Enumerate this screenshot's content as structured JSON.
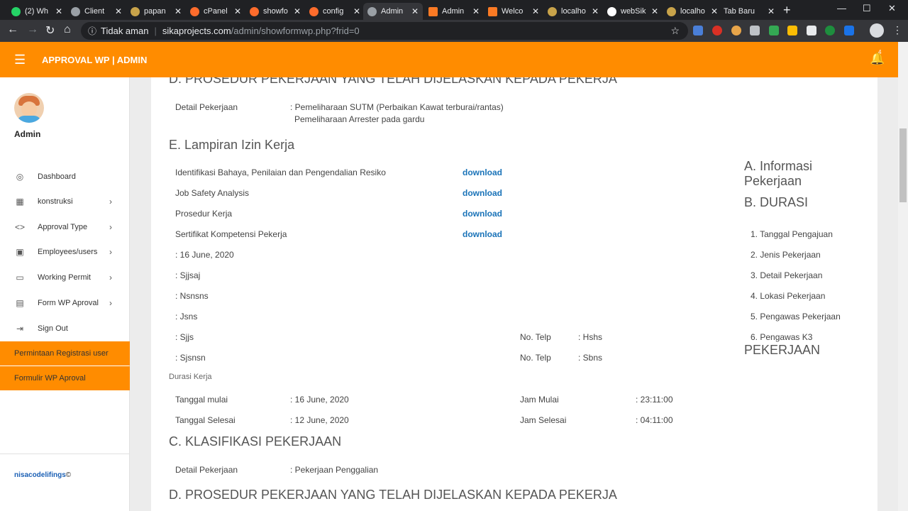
{
  "browser": {
    "tabs": [
      {
        "label": "(2) Wh",
        "icon": "whatsapp-icon",
        "color": "#25d366"
      },
      {
        "label": "Client",
        "icon": "shield-icon",
        "color": "#9aa0a6"
      },
      {
        "label": "papan",
        "icon": "crown-icon",
        "color": "#c8a34a"
      },
      {
        "label": "cPanel",
        "icon": "cpanel-icon",
        "color": "#ff6c2c"
      },
      {
        "label": "showfo",
        "icon": "cpanel-icon",
        "color": "#ff6c2c"
      },
      {
        "label": "config",
        "icon": "cpanel-icon",
        "color": "#ff6c2c"
      },
      {
        "label": "Admin",
        "icon": "globe-icon",
        "color": "#9aa0a6"
      },
      {
        "label": "Admin",
        "icon": "xampp-icon",
        "color": "#fb7a24"
      },
      {
        "label": "Welco",
        "icon": "xampp-icon",
        "color": "#fb7a24"
      },
      {
        "label": "localho",
        "icon": "crown-icon",
        "color": "#c8a34a"
      },
      {
        "label": "webSik",
        "icon": "github-icon",
        "color": "#ffffff"
      },
      {
        "label": "localho",
        "icon": "crown-icon",
        "color": "#c8a34a"
      },
      {
        "label": "Tab Baru",
        "icon": "",
        "color": ""
      }
    ],
    "address": {
      "security": "Tidak aman",
      "host": "sikaprojects.com",
      "path": "/admin/showformwp.php?frid=0"
    }
  },
  "app": {
    "brand": "APPROVAL WP | ADMIN",
    "notif_count": "4",
    "user": "Admin",
    "accent": "#ff8c00"
  },
  "sidebar": {
    "items": [
      {
        "label": "Dashboard",
        "icon": "palette-icon",
        "chevron": false
      },
      {
        "label": "konstruksi",
        "icon": "grid-icon",
        "chevron": true
      },
      {
        "label": "Approval Type",
        "icon": "code-icon",
        "chevron": true
      },
      {
        "label": "Employees/users",
        "icon": "person-card-icon",
        "chevron": true
      },
      {
        "label": "Working Permit",
        "icon": "monitor-icon",
        "chevron": true
      },
      {
        "label": "Form WP Aproval",
        "icon": "document-icon",
        "chevron": true
      },
      {
        "label": "Sign Out",
        "icon": "sign-out-icon",
        "chevron": false
      }
    ],
    "highlighted": [
      "Permintaan Registrasi user",
      "Formulir WP Aproval"
    ],
    "footer": "nisacodelifings",
    "footer_suffix": "©"
  },
  "content": {
    "heading_d_top": "D. PROSEDUR PEKERJAAN YANG TELAH DIJELASKAN KEPADA PEKERJA",
    "detail_label": "Detail Pekerjaan",
    "detail_line1": ": Pemeliharaan SUTM (Perbaikan Kawat terburai/rantas)",
    "detail_line2": "Pemeliharaan Arrester pada gardu",
    "heading_e": "E. Lampiran Izin Kerja",
    "attachments": [
      {
        "label": "Identifikasi Bahaya, Penilaian dan Pengendalian Resiko",
        "link": "download"
      },
      {
        "label": "Job Safety Analysis",
        "link": "download"
      },
      {
        "label": "Prosedur Kerja",
        "link": "download"
      },
      {
        "label": "Sertifikat Kompetensi Pekerja",
        "link": "download"
      }
    ],
    "values": [
      ": 16 June, 2020",
      ": Sjjsaj",
      ": Nsnsns",
      ": Jsns",
      ": Sjjs",
      ": Sjsnsn"
    ],
    "telp_label": "No. Telp",
    "telp_values": [
      ": Hshs",
      ": Sbns"
    ],
    "durasi_label": "Durasi Kerja",
    "tanggal_mulai_label": "Tanggal mulai",
    "tanggal_mulai": ": 16 June, 2020",
    "tanggal_selesai_label": "Tanggal Selesai",
    "tanggal_selesai": ": 12 June, 2020",
    "jam_mulai_label": "Jam Mulai",
    "jam_mulai": ": 23:11:00",
    "jam_selesai_label": "Jam Selesai",
    "jam_selesai": ": 04:11:00",
    "heading_c": "C. KLASIFIKASI PEKERJAAN",
    "detail_label2": "Detail Pekerjaan",
    "detail_value2": ": Pekerjaan Penggalian",
    "heading_d_bottom": "D. PROSEDUR PEKERJAAN YANG TELAH DIJELASKAN KEPADA PEKERJA"
  },
  "right_panel": {
    "heading_a_line1": "A. Informasi",
    "heading_a_line2": "Pekerjaan",
    "heading_b": "B. DURASI",
    "items": [
      "1. Tanggal Pengajuan",
      "2. Jenis Pekerjaan",
      "3. Detail Pekerjaan",
      "4. Lokasi Pekerjaan",
      "5. Pengawas Pekerjaan",
      "6. Pengawas K3"
    ],
    "heading_pekerjaan": "PEKERJAAN"
  }
}
